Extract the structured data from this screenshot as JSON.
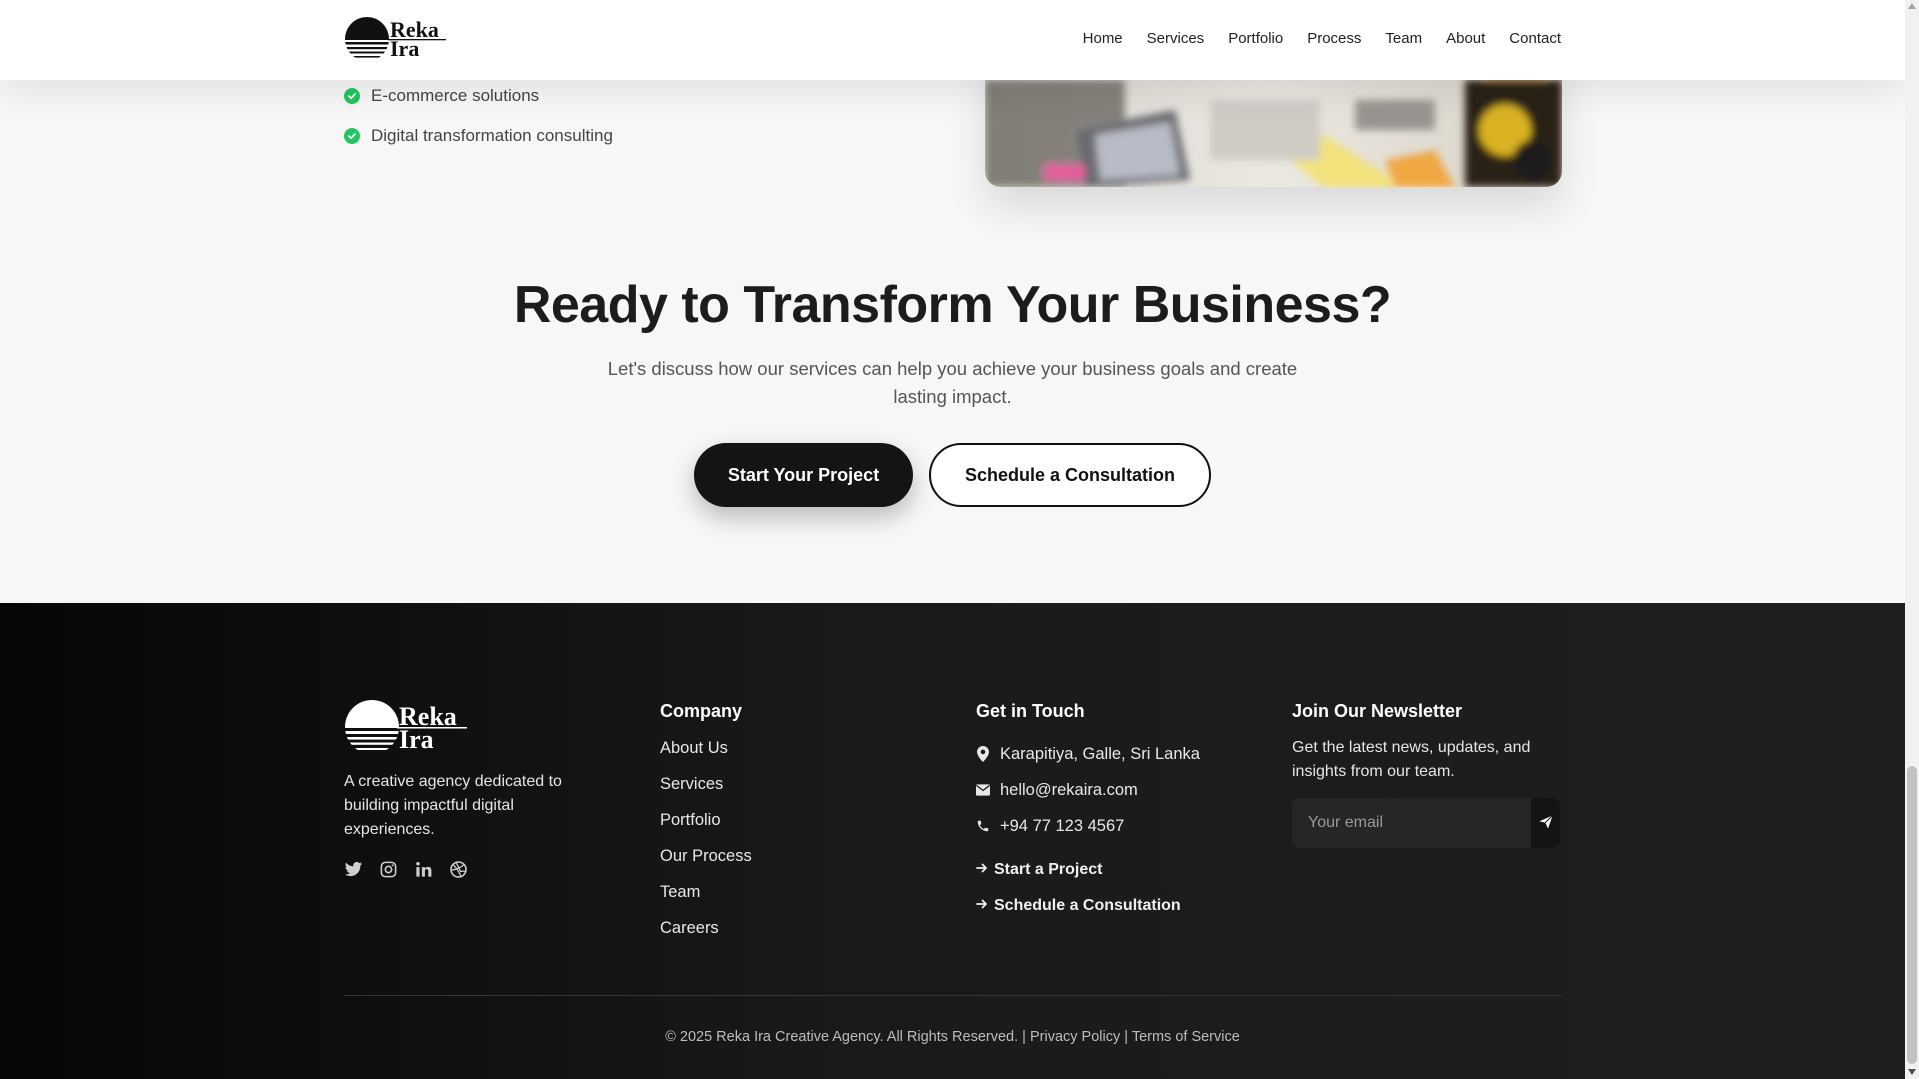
{
  "header": {
    "logo_text_line1": "Reka",
    "logo_text_line2": "Ira",
    "nav": [
      "Home",
      "Services",
      "Portfolio",
      "Process",
      "Team",
      "About",
      "Contact"
    ]
  },
  "features": [
    "E-commerce solutions",
    "Digital transformation consulting"
  ],
  "cta": {
    "title": "Ready to Transform Your Business?",
    "subtitle": "Let's discuss how our services can help you achieve your business goals and create lasting impact.",
    "primary_button": "Start Your Project",
    "secondary_button": "Schedule a Consultation"
  },
  "footer": {
    "description": "A creative agency dedicated to building impactful digital experiences.",
    "socials": [
      "twitter-icon",
      "instagram-icon",
      "linkedin-icon",
      "dribbble-icon"
    ],
    "company": {
      "heading": "Company",
      "links": [
        "About Us",
        "Services",
        "Portfolio",
        "Our Process",
        "Team",
        "Careers"
      ]
    },
    "contact": {
      "heading": "Get in Touch",
      "address": "Karapitiya, Galle, Sri Lanka",
      "email": "hello@rekaira.com",
      "phone": "+94 77 123 4567",
      "link1": "Start a Project",
      "link2": "Schedule a Consultation"
    },
    "newsletter": {
      "heading": "Join Our Newsletter",
      "text": "Get the latest news, updates, and insights from our team.",
      "placeholder": "Your email"
    },
    "copyright": "© 2025 Reka Ira Creative Agency. All Rights Reserved.",
    "separator": "|",
    "privacy": "Privacy Policy",
    "terms": "Terms of Service"
  },
  "colors": {
    "accent_green": "#22c55e",
    "dark": "#141414",
    "footer_bg": "#1a1a1a"
  }
}
